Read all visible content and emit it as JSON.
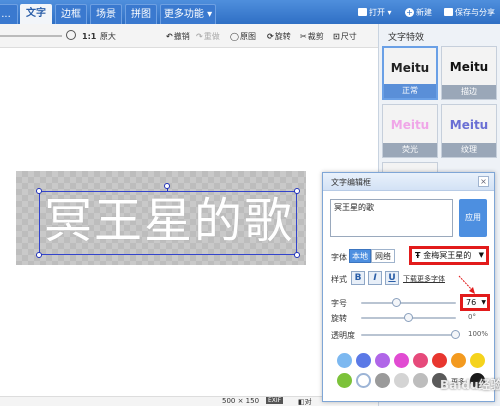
{
  "topbar": {
    "tabs": [
      {
        "label": "...",
        "active": false
      },
      {
        "label": "文字",
        "active": true
      },
      {
        "label": "边框",
        "active": false
      },
      {
        "label": "场景",
        "active": false
      },
      {
        "label": "拼图",
        "active": false
      },
      {
        "label": "更多功能",
        "active": false
      }
    ],
    "more_arrow": "▾",
    "open_label": "打开",
    "new_label": "新建",
    "save_label": "保存与分享"
  },
  "toolbar": {
    "zoom_ratio": "1:1",
    "original_size": "原大",
    "undo": "撤销",
    "redo": "重做",
    "original_image": "原图",
    "rotate": "旋转",
    "crop": "裁剪",
    "size": "尺寸"
  },
  "canvas": {
    "art_text": "冥王星的歌",
    "dimensions": "500 × 150",
    "exif_badge": "EXIF",
    "compare_label": "对"
  },
  "right_panel": {
    "title": "文字特效",
    "effects": [
      {
        "preview": "Meitu",
        "label": "正常",
        "color": "#222222"
      },
      {
        "preview": "Meitu",
        "label": "描边",
        "color": "#111111"
      },
      {
        "preview": "Meitu",
        "label": "荧光",
        "color": "#f0a6e8"
      },
      {
        "preview": "Meitu",
        "label": "纹理",
        "color": "#6a6fd4"
      }
    ]
  },
  "editor": {
    "title": "文字编辑框",
    "close": "×",
    "text_value": "冥王星的歌",
    "apply_label": "应用",
    "font_label": "字体",
    "font_source_local": "本地",
    "font_source_online": "网络",
    "font_name": "金梅冥王星的",
    "style_label": "样式",
    "bold": "B",
    "italic": "I",
    "underline": "U",
    "download_link": "下载更多字体",
    "size_label": "字号",
    "size_value": "76",
    "rotate_label": "旋转",
    "rotate_value": "0°",
    "opacity_label": "透明度",
    "opacity_value": "100%",
    "more_label": "更多",
    "swatches_row1": [
      "#7cb8f0",
      "#5b79e6",
      "#b066e8",
      "#e14bd2",
      "#e64a7b",
      "#e8362f",
      "#f39a1f",
      "#f5d31c"
    ],
    "swatches_row2": [
      "#7cc23a",
      "#ffffff",
      "#9a9a9a",
      "#d4d4d4",
      "#bdbdbd",
      "#5a5a5a",
      "#ffffff",
      "#1a1a1a"
    ]
  },
  "watermark": "Baidu经验"
}
